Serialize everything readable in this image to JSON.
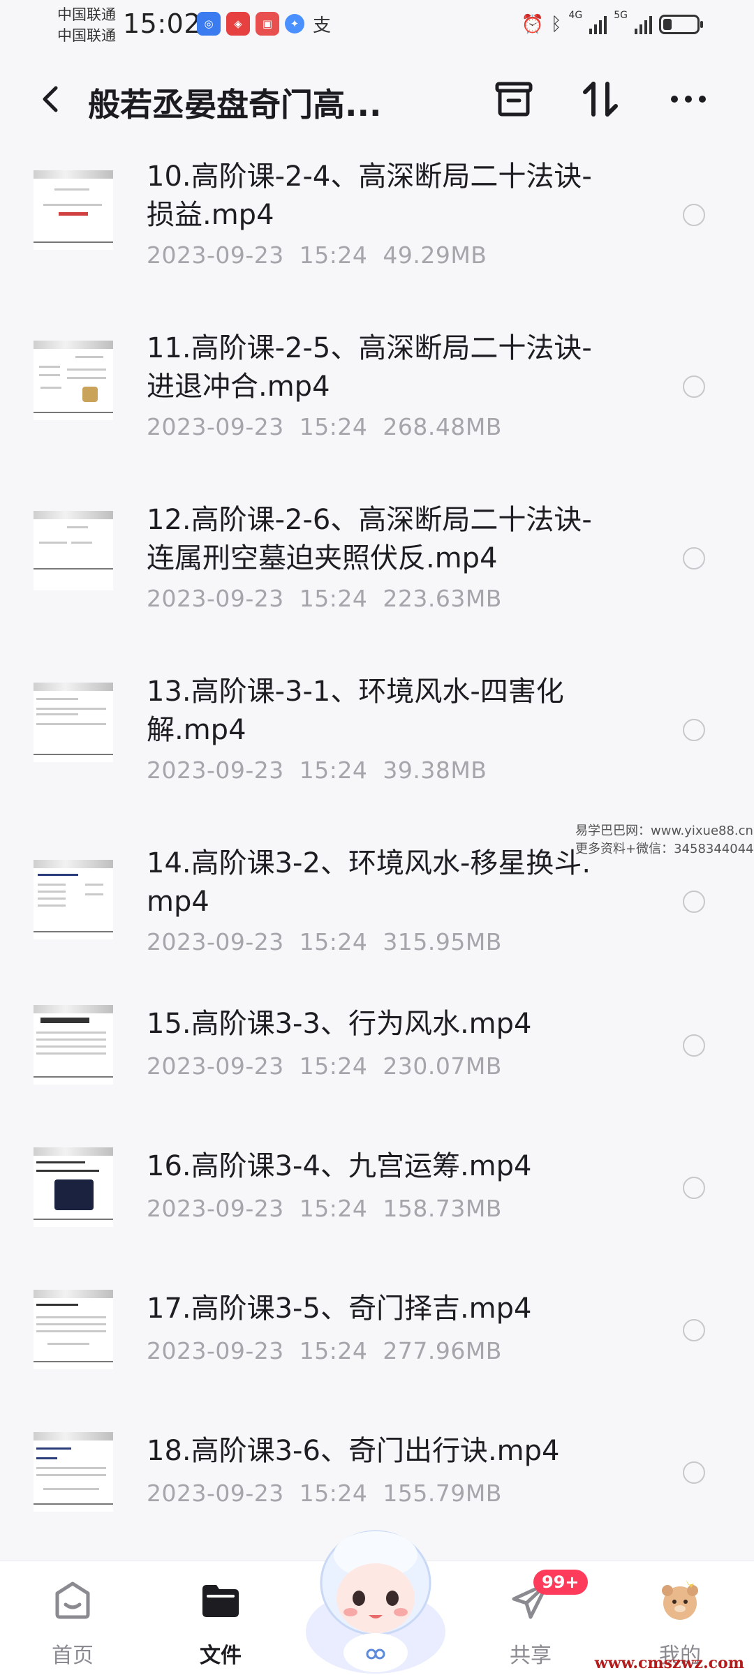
{
  "status_bar": {
    "carrier_1": "中国联通",
    "carrier_2": "中国联通",
    "time": "15:02",
    "network_1": "4G",
    "network_2": "5G"
  },
  "header": {
    "title": "般若丞晏盘奇门高..."
  },
  "files": [
    {
      "name": "10.高阶课-2-4、高深断局二十法诀-损益.mp4",
      "date": "2023-09-23",
      "time": "15:24",
      "size": "49.29MB"
    },
    {
      "name": "11.高阶课-2-5、高深断局二十法诀-进退冲合.mp4",
      "date": "2023-09-23",
      "time": "15:24",
      "size": "268.48MB"
    },
    {
      "name": "12.高阶课-2-6、高深断局二十法诀-连属刑空墓迫夹照伏反.mp4",
      "date": "2023-09-23",
      "time": "15:24",
      "size": "223.63MB"
    },
    {
      "name": "13.高阶课-3-1、环境风水-四害化解.mp4",
      "date": "2023-09-23",
      "time": "15:24",
      "size": "39.38MB"
    },
    {
      "name": "14.高阶课3-2、环境风水-移星换斗.mp4",
      "date": "2023-09-23",
      "time": "15:24",
      "size": "315.95MB"
    },
    {
      "name": "15.高阶课3-3、行为风水.mp4",
      "date": "2023-09-23",
      "time": "15:24",
      "size": "230.07MB"
    },
    {
      "name": "16.高阶课3-4、九宫运筹.mp4",
      "date": "2023-09-23",
      "time": "15:24",
      "size": "158.73MB"
    },
    {
      "name": "17.高阶课3-5、奇门择吉.mp4",
      "date": "2023-09-23",
      "time": "15:24",
      "size": "277.96MB"
    },
    {
      "name": "18.高阶课3-6、奇门出行诀.mp4",
      "date": "2023-09-23",
      "time": "15:24",
      "size": "155.79MB"
    }
  ],
  "watermark": {
    "line_1": "易学巴巴网：www.yixue88.cn",
    "line_2": "更多资料+微信：3458344044",
    "footer": "www.cmszwz.com"
  },
  "nav": {
    "home": "首页",
    "files": "文件",
    "share": "共享",
    "share_badge": "99+",
    "mine": "我的"
  }
}
